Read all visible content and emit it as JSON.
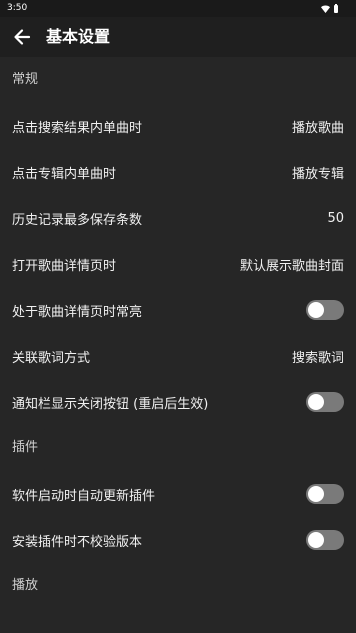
{
  "status_bar": {
    "time": "3:50",
    "icons": [
      "wifi-icon",
      "battery-icon"
    ]
  },
  "app_bar": {
    "back_icon": "arrow-left-icon",
    "title": "基本设置"
  },
  "colors": {
    "background": "#262626",
    "app_bar": "#1f1f1f",
    "switch_track_off": "#7a7a7a",
    "switch_knob": "#ffffff"
  },
  "sections": {
    "general": {
      "title": "常规",
      "items": [
        {
          "label": "点击搜索结果内单曲时",
          "value": "播放歌曲"
        },
        {
          "label": "点击专辑内单曲时",
          "value": "播放专辑"
        },
        {
          "label": "历史记录最多保存条数",
          "value": "50"
        },
        {
          "label": "打开歌曲详情页时",
          "value": "默认展示歌曲封面"
        },
        {
          "label": "处于歌曲详情页时常亮",
          "toggle": false
        },
        {
          "label": "关联歌词方式",
          "value": "搜索歌词"
        },
        {
          "label": "通知栏显示关闭按钮 (重启后生效)",
          "toggle": false
        }
      ]
    },
    "plugins": {
      "title": "插件",
      "items": [
        {
          "label": "软件启动时自动更新插件",
          "toggle": false
        },
        {
          "label": "安装插件时不校验版本",
          "toggle": false
        }
      ]
    },
    "playback": {
      "title": "播放"
    }
  }
}
